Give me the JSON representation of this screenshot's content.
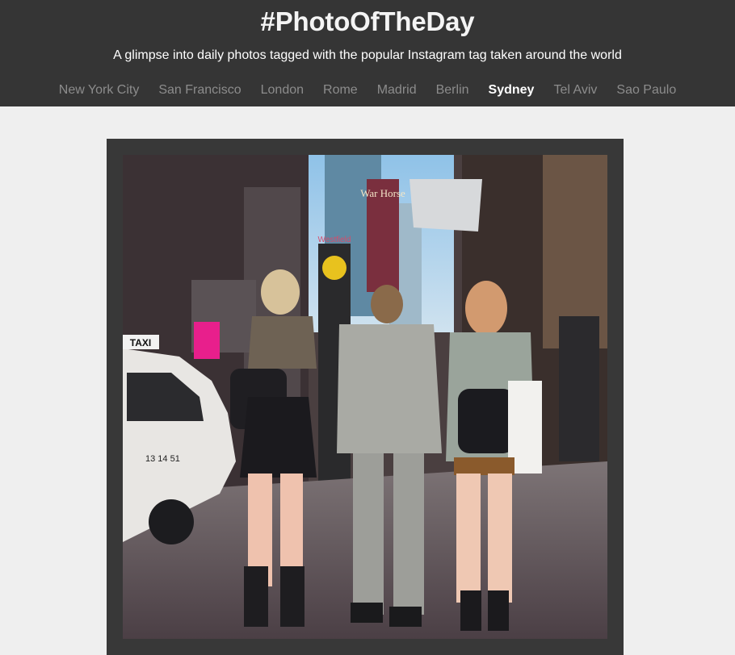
{
  "header": {
    "title": "#PhotoOfTheDay",
    "tagline": "A glimpse into daily photos tagged with the popular Instagram tag taken around the world"
  },
  "cities": [
    {
      "label": "New York City",
      "active": false
    },
    {
      "label": "San Francisco",
      "active": false
    },
    {
      "label": "London",
      "active": false
    },
    {
      "label": "Rome",
      "active": false
    },
    {
      "label": "Madrid",
      "active": false
    },
    {
      "label": "Berlin",
      "active": false
    },
    {
      "label": "Sydney",
      "active": true
    },
    {
      "label": "Tel Aviv",
      "active": false
    },
    {
      "label": "Sao Paulo",
      "active": false
    }
  ],
  "photo": {
    "sign_text_1": "TAXI",
    "sign_text_2": "War Horse",
    "sign_text_3": "Westfield",
    "plate_text": "13 14 51"
  }
}
